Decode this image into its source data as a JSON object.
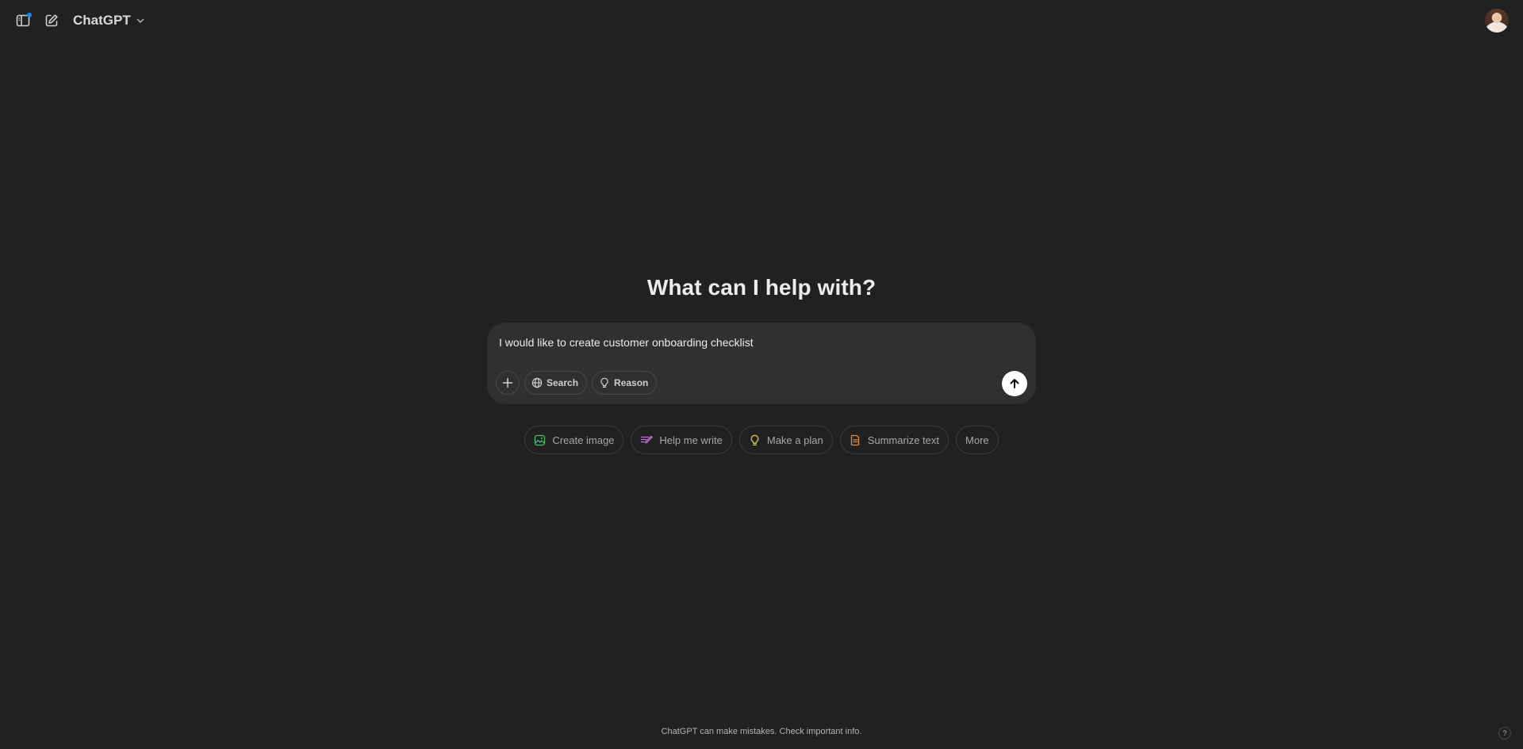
{
  "header": {
    "model_name": "ChatGPT",
    "icons": {
      "sidebar_toggle": "sidebar-icon",
      "new_chat": "edit-icon",
      "model_dropdown": "chevron-down-icon"
    },
    "notification_color": "#0d8bf2"
  },
  "main": {
    "headline": "What can I help with?",
    "composer": {
      "input_value": "I would like to create customer onboarding checklist",
      "tools": {
        "attach_icon": "plus-icon",
        "search_label": "Search",
        "reason_label": "Reason"
      },
      "send_icon": "arrow-up-icon"
    },
    "suggestions": [
      {
        "label": "Create image",
        "icon": "image-icon",
        "color": "#4ab96a"
      },
      {
        "label": "Help me write",
        "icon": "pen-icon",
        "color": "#c06fd9"
      },
      {
        "label": "Make a plan",
        "icon": "lightbulb-icon",
        "color": "#e2c541"
      },
      {
        "label": "Summarize text",
        "icon": "document-icon",
        "color": "#e08b4a"
      },
      {
        "label": "More",
        "icon": "",
        "color": ""
      }
    ]
  },
  "footer": {
    "disclaimer": "ChatGPT can make mistakes. Check important info.",
    "help_label": "?"
  }
}
